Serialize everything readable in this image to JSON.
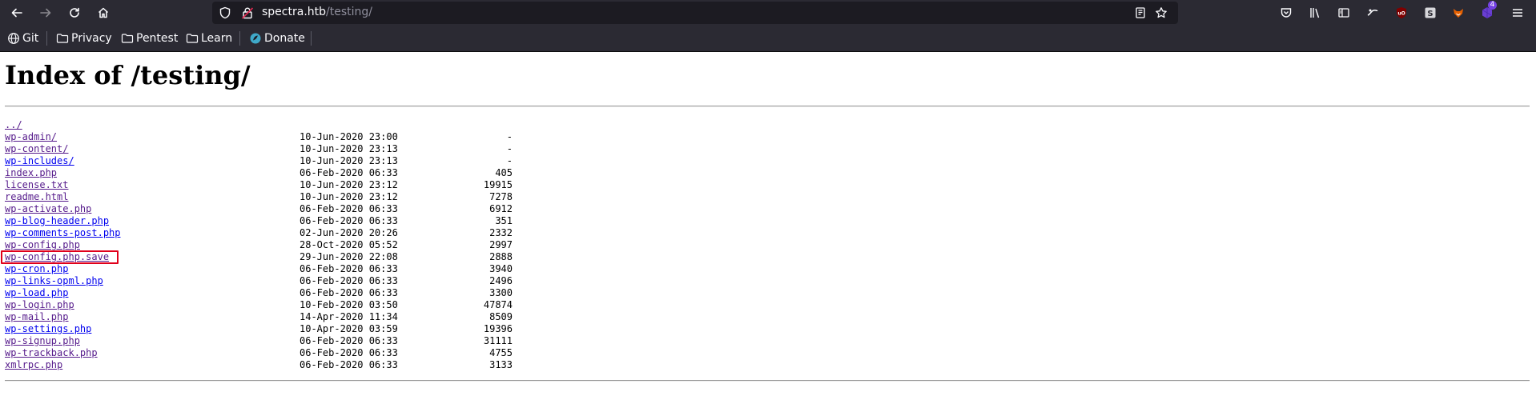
{
  "browser": {
    "url_host": "spectra.htb",
    "url_path": "/testing/",
    "extension_badge": "4",
    "bookmarks": [
      {
        "label": "Git",
        "icon": "globe-icon"
      },
      {
        "label": "Privacy",
        "icon": "folder-icon"
      },
      {
        "label": "Pentest",
        "icon": "folder-icon"
      },
      {
        "label": "Learn",
        "icon": "folder-icon"
      },
      {
        "label": "Donate",
        "icon": "donate-icon"
      }
    ]
  },
  "page": {
    "title": "Index of /testing/",
    "parent_link": "../",
    "highlighted_entry": "wp-config.php.save",
    "entries": [
      {
        "name": "wp-admin/",
        "date": "10-Jun-2020 23:00",
        "size": "-",
        "visited": true
      },
      {
        "name": "wp-content/",
        "date": "10-Jun-2020 23:13",
        "size": "-",
        "visited": true
      },
      {
        "name": "wp-includes/",
        "date": "10-Jun-2020 23:13",
        "size": "-",
        "visited": false
      },
      {
        "name": "index.php",
        "date": "06-Feb-2020 06:33",
        "size": "405",
        "visited": true
      },
      {
        "name": "license.txt",
        "date": "10-Jun-2020 23:12",
        "size": "19915",
        "visited": true
      },
      {
        "name": "readme.html",
        "date": "10-Jun-2020 23:12",
        "size": "7278",
        "visited": true
      },
      {
        "name": "wp-activate.php",
        "date": "06-Feb-2020 06:33",
        "size": "6912",
        "visited": true
      },
      {
        "name": "wp-blog-header.php",
        "date": "06-Feb-2020 06:33",
        "size": "351",
        "visited": false
      },
      {
        "name": "wp-comments-post.php",
        "date": "02-Jun-2020 20:26",
        "size": "2332",
        "visited": false
      },
      {
        "name": "wp-config.php",
        "date": "28-Oct-2020 05:52",
        "size": "2997",
        "visited": true
      },
      {
        "name": "wp-config.php.save",
        "date": "29-Jun-2020 22:08",
        "size": "2888",
        "visited": true
      },
      {
        "name": "wp-cron.php",
        "date": "06-Feb-2020 06:33",
        "size": "3940",
        "visited": false
      },
      {
        "name": "wp-links-opml.php",
        "date": "06-Feb-2020 06:33",
        "size": "2496",
        "visited": false
      },
      {
        "name": "wp-load.php",
        "date": "06-Feb-2020 06:33",
        "size": "3300",
        "visited": false
      },
      {
        "name": "wp-login.php",
        "date": "10-Feb-2020 03:50",
        "size": "47874",
        "visited": true
      },
      {
        "name": "wp-mail.php",
        "date": "14-Apr-2020 11:34",
        "size": "8509",
        "visited": true
      },
      {
        "name": "wp-settings.php",
        "date": "10-Apr-2020 03:59",
        "size": "19396",
        "visited": false
      },
      {
        "name": "wp-signup.php",
        "date": "06-Feb-2020 06:33",
        "size": "31111",
        "visited": true
      },
      {
        "name": "wp-trackback.php",
        "date": "06-Feb-2020 06:33",
        "size": "4755",
        "visited": true
      },
      {
        "name": "xmlrpc.php",
        "date": "06-Feb-2020 06:33",
        "size": "3133",
        "visited": true
      }
    ]
  },
  "colors": {
    "chrome": "#2b2a33",
    "urlbar": "#1c1b22",
    "link_visited": "#551a8b",
    "link_unvisited": "#0000ee",
    "highlight": "#e0001b"
  }
}
